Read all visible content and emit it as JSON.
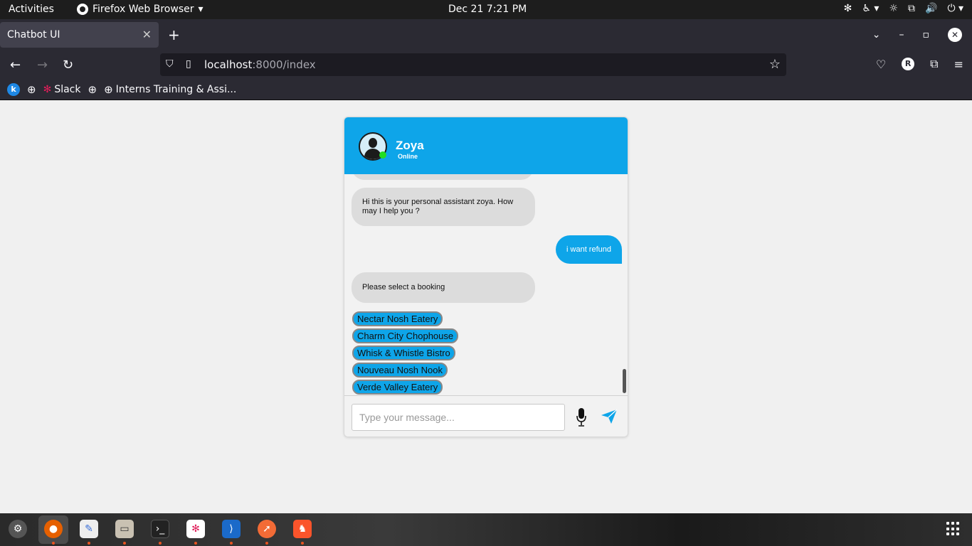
{
  "system": {
    "activities": "Activities",
    "app_name": "Firefox Web Browser",
    "clock": "Dec 21  7:21 PM"
  },
  "browser": {
    "tab_title": "Chatbot UI",
    "url_host": "localhost",
    "url_path": ":8000/index",
    "profile_initial": "R",
    "bookmarks": [
      "Slack",
      "Interns Training & Assi..."
    ]
  },
  "chat": {
    "bot_name": "Zoya",
    "status": "Online",
    "accent_color": "#0ea5e9",
    "messages": [
      {
        "from": "bot",
        "text": "Hi this is your personal assistant zoya. How may I help you ?"
      },
      {
        "from": "user",
        "text": "i want refund"
      },
      {
        "from": "bot",
        "text": "Please select a booking"
      }
    ],
    "options": [
      "Nectar Nosh Eatery",
      "Charm City Chophouse",
      "Whisk & Whistle Bistro",
      "Nouveau Nosh Nook",
      "Verde Valley Eatery"
    ],
    "input_placeholder": "Type your message..."
  }
}
